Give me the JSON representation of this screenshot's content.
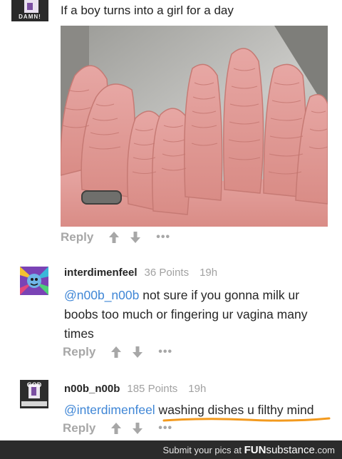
{
  "post": {
    "title": "If a boy turns into a girl for a day",
    "avatar_text": "DAMN!",
    "actions": {
      "reply_label": "Reply",
      "more_label": "•••"
    }
  },
  "comments": [
    {
      "username": "interdimenfeel",
      "points": "36 Points",
      "time": "19h",
      "mention": "@n00b_n00b",
      "text": " not sure if you gonna milk ur boobs too much or fingering ur vagina many times",
      "reply_label": "Reply",
      "more_label": "•••"
    },
    {
      "username": "n00b_n00b",
      "points": "185 Points",
      "time": "19h",
      "mention": "@interdimenfeel",
      "text": " washing dishes u filthy mind",
      "reply_label": "Reply",
      "more_label": "•••",
      "avatar_text": "GOD"
    }
  ],
  "footer": {
    "text": "Submit your pics at ",
    "brand_bold": "FUN",
    "brand_thin": "substance",
    "brand_suffix": ".com"
  },
  "colors": {
    "mention": "#3f86d6",
    "underline": "#f39a1e",
    "footer_bg": "#2b2b2b",
    "muted": "#a7a7a7"
  }
}
